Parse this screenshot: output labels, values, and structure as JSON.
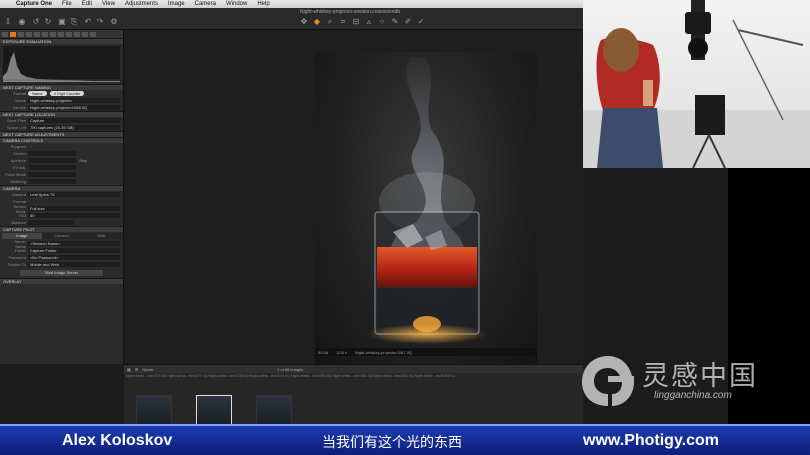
{
  "menubar": {
    "app_name": "Capture One",
    "items": [
      "File",
      "Edit",
      "View",
      "Adjustments",
      "Image",
      "Camera",
      "Window",
      "Help"
    ]
  },
  "toolbar": {
    "document_title": "Night-whiskey-projector-session.cosessiondb"
  },
  "left_panel": {
    "sections": {
      "exposure": "Exposure Evaluation",
      "naming": "Next Capture Naming",
      "location": "Next Capture Location",
      "adjustments": "Next Capture Adjustments",
      "camera_controls": "Camera Controls",
      "camera": "Camera",
      "pilot": "Capture Pilot",
      "overlay": "Overlay"
    },
    "naming": {
      "format_label": "Format",
      "format_token_1": "Name",
      "format_token_2": "4 Digit Counter",
      "name_label": "Name",
      "name_value": "Night-whiskey-projector",
      "sample_label": "Sample",
      "sample_value": "Night-whiskey-projector1088.IIQ"
    },
    "location": {
      "store_label": "Store Files",
      "store_value": "Capture",
      "space_label": "Space Left",
      "space_value": "750 captures (24.35 GB)"
    },
    "camera_controls": {
      "program_label": "Program",
      "shutter_label": "Shutter",
      "aperture_label": "Aperture",
      "iso_label": "EV Adj.",
      "flash_label": "Flash Mode",
      "metering_label": "Metering",
      "step_label": "Step"
    },
    "camera": {
      "camera_label": "Camera",
      "camera_value": "Leaf Aptus 75",
      "format_label": "Format",
      "sensor_label": "Sensor Mode",
      "sensor_value": "Full size",
      "iso_label": "ISO",
      "iso_value": "50",
      "balance_label": "Balance"
    },
    "pilot": {
      "tabs": [
        "Image",
        "Camera",
        "Web"
      ],
      "server_label": "Server Name",
      "server_value": "<Session Name>",
      "folder_label": "Folder",
      "folder_value": "Capture Folder",
      "password_label": "Password",
      "password_value": "<No Password>",
      "publish_label": "Publish To",
      "publish_value": "Mobile and Web",
      "start_button": "Start Image Server"
    }
  },
  "viewer": {
    "zoom": "80:58",
    "exposure_info": "1/25 s",
    "filename": "Night-whiskey-projector1087.IIQ"
  },
  "filmstrip": {
    "sort_label": "Name",
    "count_label": "1 of 85 images",
    "names": "Night-whisk...ctor1076.IIQ  Night-whisk...ctor1077.IIQ  Night-whisk...ctor1078.IIQ  Night-whisk...ctor1079.IIQ  Night-whisk...ctor1080.IIQ  Night-whisk...ctor1081.IIQ  Night-whisk...ctor1082.IIQ  Night-whisk...ctor1083.IIQ"
  },
  "banner": {
    "presenter": "Alex Koloskov",
    "subtitle": "当我们有这个光的东西",
    "site": "www.Photigy.com"
  },
  "watermark": {
    "chinese": "灵感中国",
    "url": "lingganchina.com"
  },
  "colors": {
    "accent": "#e07a1c",
    "banner_top": "#1e3cb0",
    "banner_bottom": "#0c1f78",
    "whiskey": "#c0301a"
  }
}
